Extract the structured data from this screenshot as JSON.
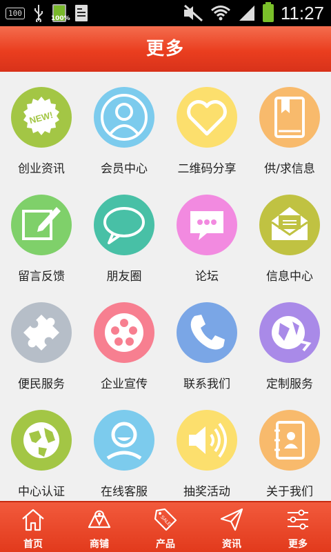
{
  "status_bar": {
    "badge": "100",
    "battery_small": "100%",
    "time": "11:27"
  },
  "header": {
    "title": "更多"
  },
  "grid": [
    {
      "label": "创业资讯",
      "icon": "new-badge-icon",
      "color": "#a3c645"
    },
    {
      "label": "会员中心",
      "icon": "member-profile-icon",
      "color": "#7ccbed"
    },
    {
      "label": "二维码分享",
      "icon": "heart-icon",
      "color": "#fcdf6d"
    },
    {
      "label": "供/求信息",
      "icon": "book-bookmark-icon",
      "color": "#f8ba6c"
    },
    {
      "label": "留言反馈",
      "icon": "edit-pencil-icon",
      "color": "#7fd06a"
    },
    {
      "label": "朋友圈",
      "icon": "speech-bubble-icon",
      "color": "#48c0a6"
    },
    {
      "label": "论坛",
      "icon": "chat-dots-icon",
      "color": "#f28ae0"
    },
    {
      "label": "信息中心",
      "icon": "envelope-icon",
      "color": "#c0c242"
    },
    {
      "label": "便民服务",
      "icon": "puzzle-icon",
      "color": "#b6bec8"
    },
    {
      "label": "企业宣传",
      "icon": "film-reel-icon",
      "color": "#f77f90"
    },
    {
      "label": "联系我们",
      "icon": "phone-icon",
      "color": "#7aa6e6"
    },
    {
      "label": "定制服务",
      "icon": "globe-arrow-icon",
      "color": "#a98ae8"
    },
    {
      "label": "中心认证",
      "icon": "globe-icon",
      "color": "#a3c645"
    },
    {
      "label": "在线客服",
      "icon": "customer-service-icon",
      "color": "#7ccbed"
    },
    {
      "label": "抽奖活动",
      "icon": "speaker-icon",
      "color": "#fcdf6d"
    },
    {
      "label": "关于我们",
      "icon": "contact-book-icon",
      "color": "#f8ba6c"
    }
  ],
  "tabbar": [
    {
      "label": "首页",
      "icon": "home-icon"
    },
    {
      "label": "商铺",
      "icon": "shop-map-icon"
    },
    {
      "label": "产品",
      "icon": "sale-tag-icon"
    },
    {
      "label": "资讯",
      "icon": "paper-plane-icon"
    },
    {
      "label": "更多",
      "icon": "sliders-icon"
    }
  ]
}
